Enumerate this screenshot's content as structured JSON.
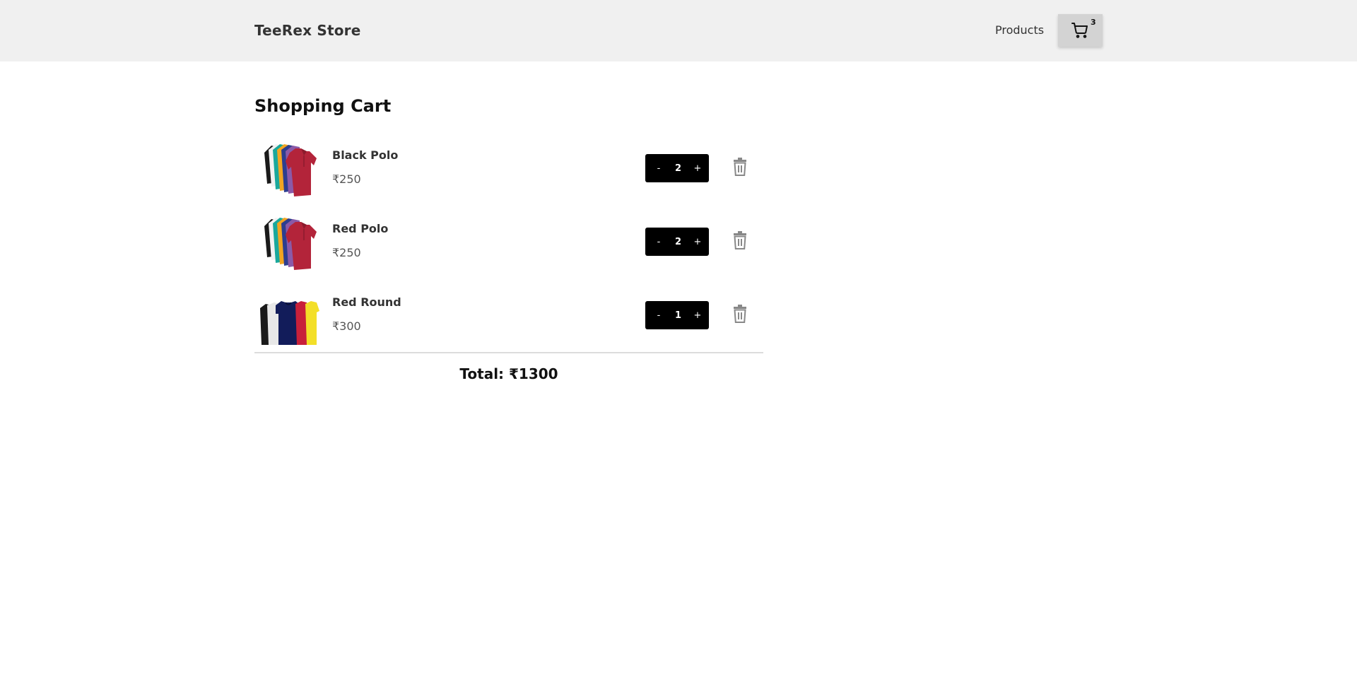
{
  "header": {
    "brand": "TeeRex Store",
    "nav_products": "Products",
    "cart_icon": "cart-icon",
    "cart_count": "3"
  },
  "page": {
    "title": "Shopping Cart"
  },
  "cart": {
    "items": [
      {
        "name": "Black Polo",
        "price": "₹250",
        "quantity": "2",
        "minus": "-",
        "plus": "+",
        "image": "polo-shirts-image",
        "delete_icon": "trash-icon"
      },
      {
        "name": "Red Polo",
        "price": "₹250",
        "quantity": "2",
        "minus": "-",
        "plus": "+",
        "image": "polo-shirts-image",
        "delete_icon": "trash-icon"
      },
      {
        "name": "Red Round",
        "price": "₹300",
        "quantity": "1",
        "minus": "-",
        "plus": "+",
        "image": "round-neck-shirts-image",
        "delete_icon": "trash-icon"
      }
    ],
    "total": "Total: ₹1300"
  },
  "colors": {
    "navbar_bg": "#f0f0f0",
    "cart_button_bg": "#d3d3d3",
    "qty_box_bg": "#000000",
    "trash_icon": "#888888"
  }
}
